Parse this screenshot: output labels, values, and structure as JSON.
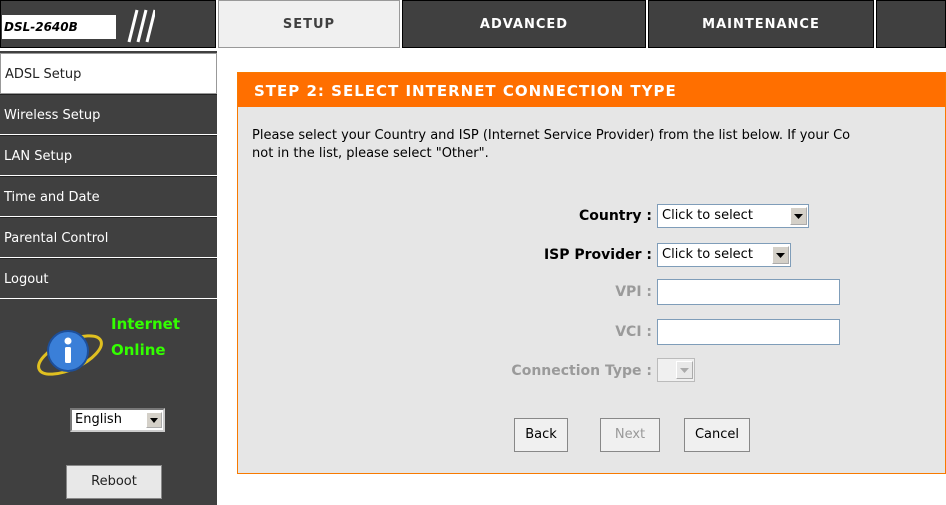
{
  "header": {
    "model": "DSL-2640B",
    "tabs": [
      {
        "label": "SETUP",
        "active": true
      },
      {
        "label": "ADVANCED",
        "active": false
      },
      {
        "label": "MAINTENANCE",
        "active": false
      }
    ]
  },
  "sidebar": {
    "items": [
      {
        "label": "ADSL Setup",
        "active": true
      },
      {
        "label": "Wireless Setup"
      },
      {
        "label": "LAN Setup"
      },
      {
        "label": "Time and Date"
      },
      {
        "label": "Parental Control"
      },
      {
        "label": "Logout"
      }
    ],
    "status_line1": "Internet",
    "status_line2": "Online",
    "language": "English",
    "reboot_label": "Reboot"
  },
  "panel": {
    "title": "STEP 2: SELECT INTERNET CONNECTION TYPE",
    "desc_line1": "Please select your Country and ISP (Internet Service Provider) from the list below. If your Co",
    "desc_line2": "not in the list, please select \"Other\".",
    "country_label": "Country :",
    "country_value": "Click to select",
    "isp_label": "ISP Provider :",
    "isp_value": "Click to select",
    "vpi_label": "VPI :",
    "vpi_value": "",
    "vci_label": "VCI :",
    "vci_value": "",
    "conn_label": "Connection Type :",
    "back_label": "Back",
    "next_label": "Next",
    "cancel_label": "Cancel"
  },
  "colors": {
    "accent": "#ff6f00",
    "sidebar_bg": "#404040",
    "status_green": "#33ff00"
  }
}
